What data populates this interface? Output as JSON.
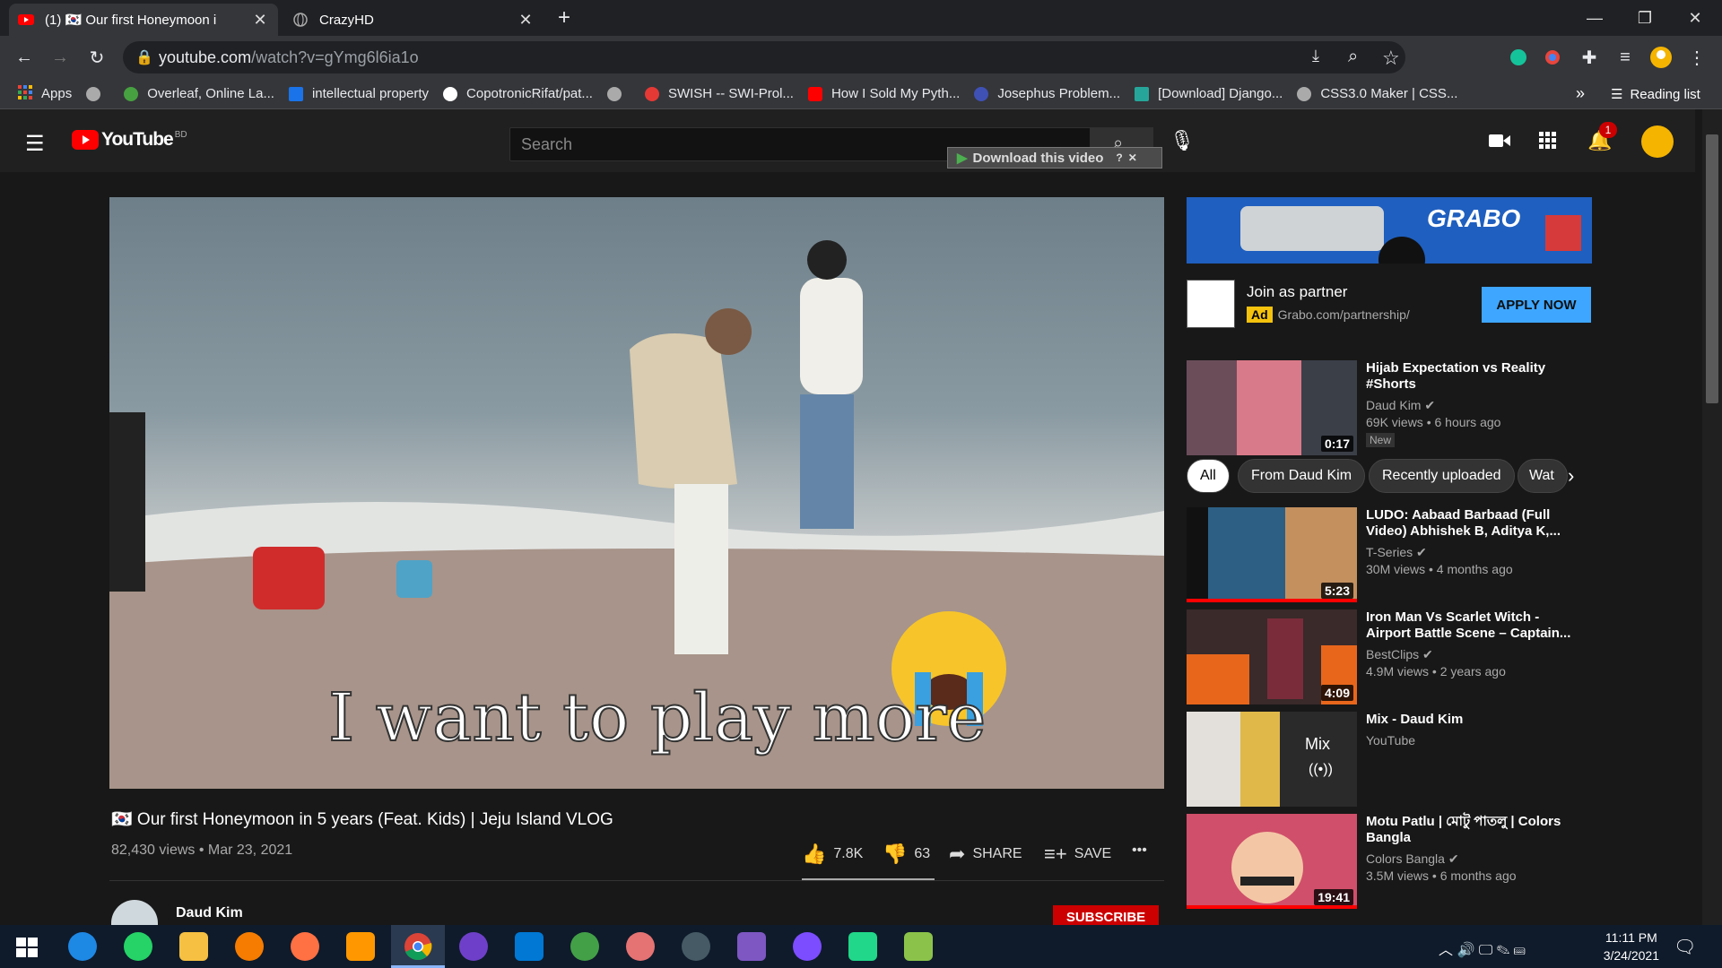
{
  "browser": {
    "tabs": [
      {
        "title": "(1) 🇰🇷 Our first Honeymoon i",
        "active": true
      },
      {
        "title": "CrazyHD",
        "active": false
      }
    ],
    "new_tab": "+",
    "url_host": "youtube.com",
    "url_path": "/watch?v=gYmg6l6ia1o",
    "bookmarks": [
      {
        "label": "Apps",
        "color": "#ea4335"
      },
      {
        "label": "",
        "color": "#aaaaaa"
      },
      {
        "label": "Overleaf, Online La...",
        "color": "#47a141"
      },
      {
        "label": "intellectual property",
        "color": "#1a73e8"
      },
      {
        "label": "CopotronicRifat/pat...",
        "color": "#ffffff"
      },
      {
        "label": "",
        "color": "#aaaaaa"
      },
      {
        "label": "SWISH -- SWI-Prol...",
        "color": "#e53935"
      },
      {
        "label": "How I Sold My Pyth...",
        "color": "#ff0000"
      },
      {
        "label": "Josephus Problem...",
        "color": "#3f51b5"
      },
      {
        "label": "[Download] Django...",
        "color": "#26a69a"
      },
      {
        "label": "CSS3.0 Maker | CSS...",
        "color": "#aaaaaa"
      }
    ],
    "bookmarks_more": "»",
    "reading_list": "Reading list"
  },
  "youtube": {
    "logo_text": "YouTube",
    "logo_region": "BD",
    "search_placeholder": "Search",
    "download_banner": "Download this video",
    "notifications_count": "1",
    "video": {
      "caption": "I want to play more",
      "title": "🇰🇷 Our first Honeymoon in 5 years (Feat. Kids) | Jeju Island VLOG",
      "views": "82,430 views • Mar 23, 2021",
      "likes": "7.8K",
      "dislikes": "63",
      "share": "SHARE",
      "save": "SAVE",
      "more": "•••",
      "channel": "Daud Kim",
      "subscribe": "SUBSCRIBE"
    },
    "ad": {
      "brand": "GRABO",
      "title": "Join as partner",
      "badge": "Ad",
      "url": "Grabo.com/partnership/",
      "cta": "APPLY NOW"
    },
    "chips": [
      "All",
      "From Daud Kim",
      "Recently uploaded",
      "Wat"
    ],
    "recommendations": [
      {
        "title": "Hijab Expectation vs Reality #Shorts",
        "channel": "Daud Kim",
        "meta": "69K views • 6 hours ago",
        "badge": "New",
        "duration": "0:17"
      },
      {
        "title": "LUDO: Aabaad Barbaad (Full Video) Abhishek B, Aditya K,...",
        "channel": "T-Series",
        "meta": "30M views • 4 months ago",
        "duration": "5:23"
      },
      {
        "title": "Iron Man Vs Scarlet Witch - Airport Battle Scene – Captain...",
        "channel": "BestClips",
        "meta": "4.9M views • 2 years ago",
        "duration": "4:09"
      },
      {
        "title": "Mix - Daud Kim",
        "channel": "YouTube",
        "meta": "",
        "duration": "Mix"
      },
      {
        "title": "Motu Patlu | মোটু পাতলু | Colors Bangla",
        "channel": "Colors Bangla",
        "meta": "3.5M views • 6 months ago",
        "duration": "19:41"
      }
    ]
  },
  "taskbar": {
    "time": "11:11 PM",
    "date": "3/24/2021"
  }
}
